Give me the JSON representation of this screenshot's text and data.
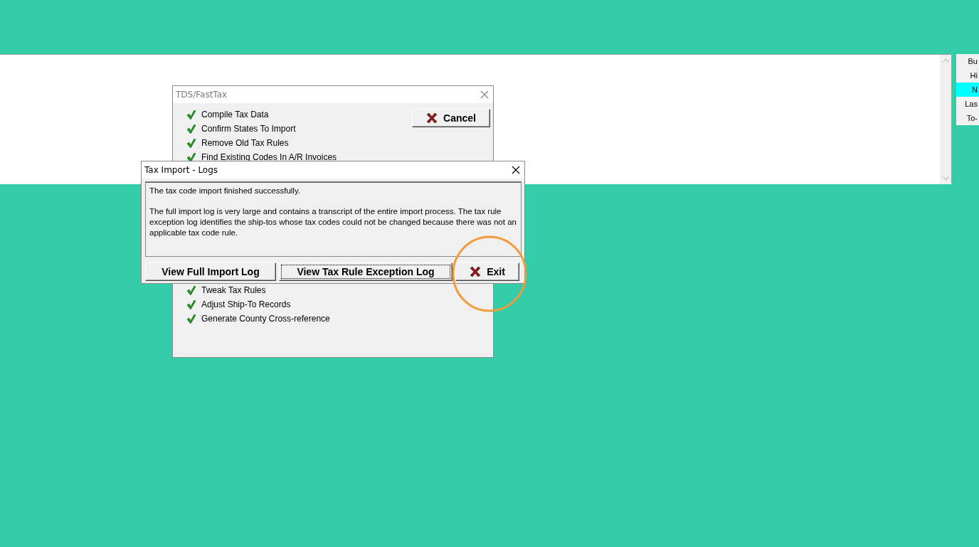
{
  "background_panel": {
    "side_list": [
      {
        "label": "Bu",
        "selected": false
      },
      {
        "label": "Hi",
        "selected": false
      },
      {
        "label": "N",
        "selected": true
      },
      {
        "label": "Las",
        "selected": false
      },
      {
        "label": "To-",
        "selected": false
      }
    ]
  },
  "progress_window": {
    "title": "TDS/FastTax",
    "cancel_button": "Cancel",
    "steps_top": [
      {
        "label": "Compile Tax Data",
        "done": true
      },
      {
        "label": "Confirm States To Import",
        "done": true
      },
      {
        "label": "Remove Old Tax Rules",
        "done": true
      },
      {
        "label": "Find Existing Codes In A/R Invoices",
        "done": true
      }
    ],
    "steps_bottom": [
      {
        "label": "Tweak Tax Rules",
        "done": true
      },
      {
        "label": "Adjust Ship-To Records",
        "done": true
      },
      {
        "label": "Generate County Cross-reference",
        "done": true
      }
    ]
  },
  "logs_dialog": {
    "title": "Tax Import - Logs",
    "message": [
      "The tax code import finished successfully.",
      "The full import log is very large and contains a transcript of the entire import process.  The tax rule exception log identifies the ship-tos whose tax codes could not be changed because there was not an applicable tax code rule."
    ],
    "buttons": [
      {
        "label": "View Full Import Log",
        "kind": "plain",
        "focused": false
      },
      {
        "label": "View Tax Rule Exception Log",
        "kind": "plain",
        "focused": true
      },
      {
        "label": "Exit",
        "kind": "exit",
        "focused": false
      }
    ]
  }
}
